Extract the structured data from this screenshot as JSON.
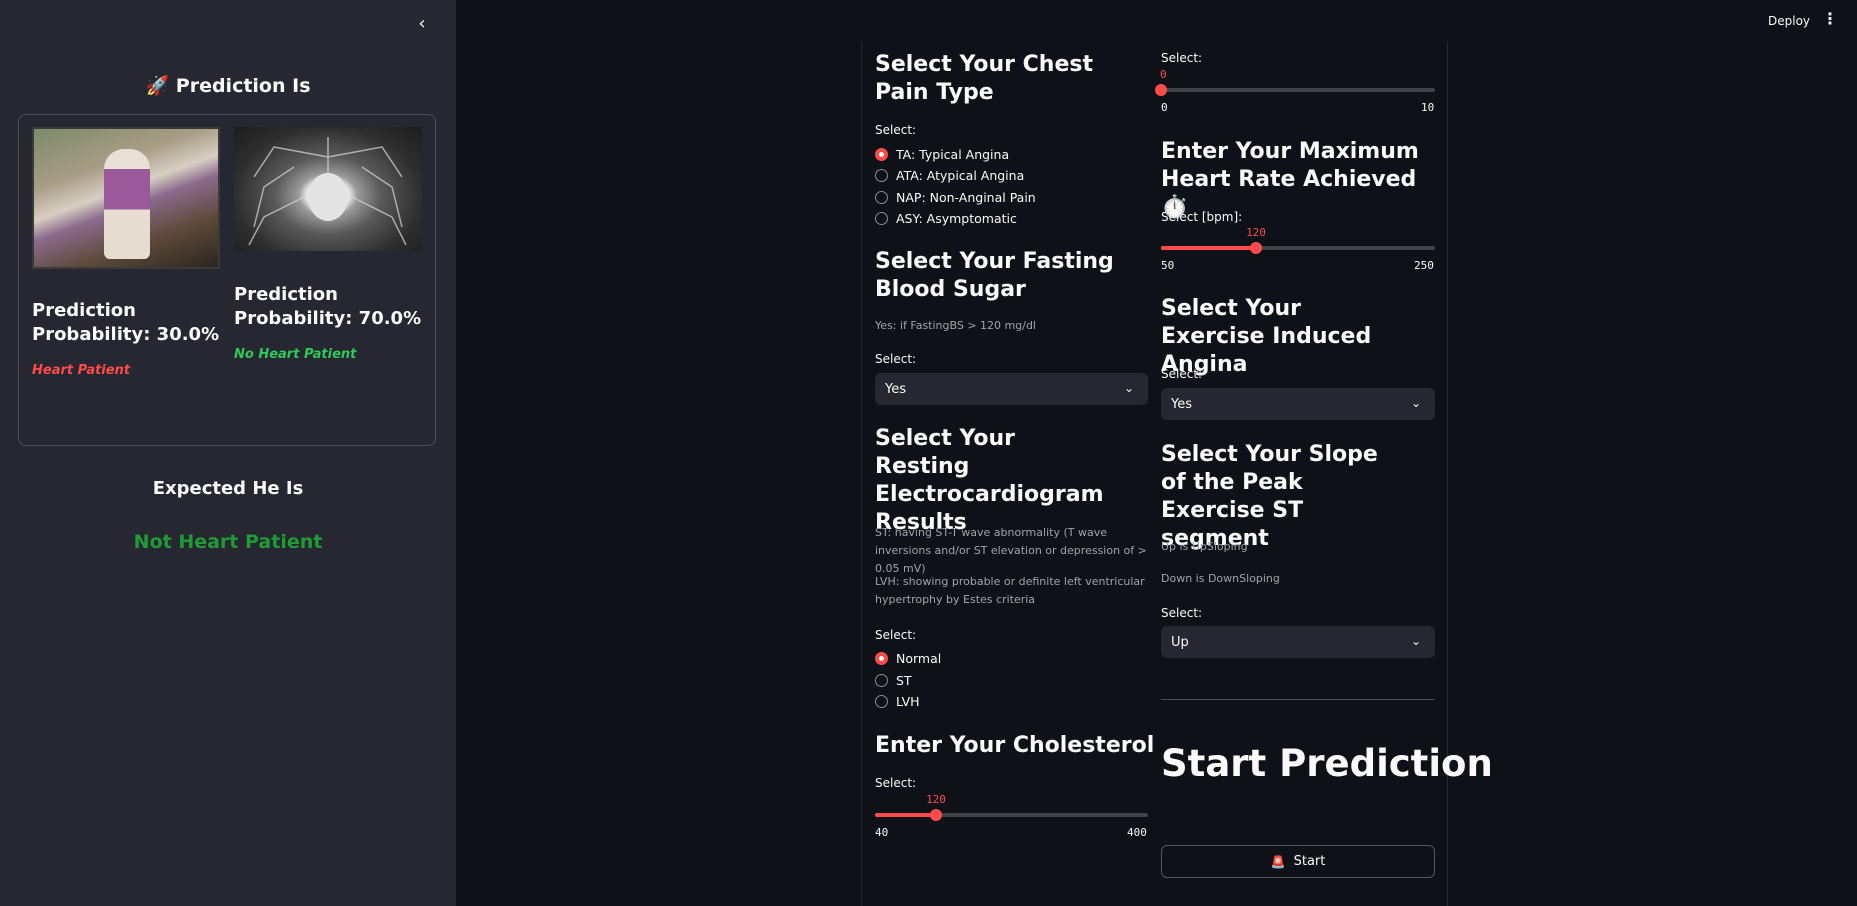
{
  "header": {
    "deploy_label": "Deploy",
    "menu_icon": "⋮"
  },
  "sidebar": {
    "collapse_icon": "‹",
    "title": "🚀 Prediction Is",
    "results": [
      {
        "probability_text": "Prediction Probability: 30.0%",
        "verdict": "Heart Patient",
        "verdict_color": "#ff4b4b"
      },
      {
        "probability_text": "Prediction Probability: 70.0%",
        "verdict": "No Heart Patient",
        "verdict_color": "#2fc85a"
      }
    ],
    "expected_title": "Expected He Is",
    "expected_value": "Not Heart Patient"
  },
  "left_col": {
    "chest_pain": {
      "title": "Select Your Chest Pain Type",
      "label": "Select:",
      "options": [
        "TA: Typical Angina",
        "ATA: Atypical Angina",
        "NAP: Non-Anginal Pain",
        "ASY: Asymptomatic"
      ],
      "selected_index": 0
    },
    "fasting": {
      "title": "Select Your Fasting Blood Sugar",
      "caption": "Yes: if FastingBS > 120 mg/dl",
      "label": "Select:",
      "value": "Yes"
    },
    "ecg": {
      "title": "Select Your Resting Electrocardiogram Results",
      "caption1": "ST: having ST-T wave abnormality (T wave inversions and/or ST elevation or depression of > 0.05 mV)",
      "caption2": "LVH: showing probable or definite left ventricular hypertrophy by Estes criteria",
      "label": "Select:",
      "options": [
        "Normal",
        "ST",
        "LVH"
      ],
      "selected_index": 0
    },
    "cholesterol": {
      "title": "Enter Your Cholesterol",
      "label": "Select:",
      "min": "40",
      "max": "400",
      "value": "120"
    }
  },
  "right_col": {
    "oldpeak": {
      "label": "Select:",
      "min": "0",
      "max": "10",
      "value": "0"
    },
    "max_hr": {
      "title": "Enter Your Maximum Heart Rate Achieved ⏱️",
      "label": "Select [bpm]:",
      "min": "50",
      "max": "250",
      "value": "120"
    },
    "angina": {
      "title": "Select Your Exercise Induced Angina",
      "label": "Select:",
      "value": "Yes"
    },
    "slope": {
      "title": "Select Your Slope of the Peak Exercise ST segment",
      "caption1": "Up is UpSloping",
      "caption2": "Down is DownSloping",
      "label": "Select:",
      "value": "Up"
    },
    "start": {
      "title": "Start Prediction",
      "button_label": "Start",
      "button_icon": "🚨"
    }
  }
}
